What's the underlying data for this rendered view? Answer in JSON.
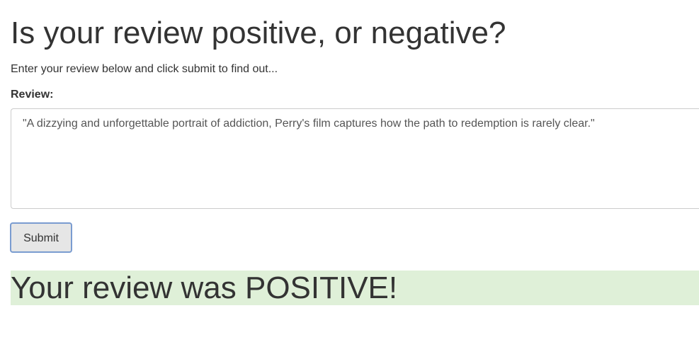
{
  "header": {
    "title": "Is your review positive, or negative?",
    "subtitle": "Enter your review below and click submit to find out..."
  },
  "form": {
    "review_label": "Review:",
    "review_value": "\"A dizzying and unforgettable portrait of addiction, Perry's film captures how the path to redemption is rarely clear.\"",
    "submit_label": "Submit"
  },
  "result": {
    "text": "Your review was POSITIVE!",
    "background_color": "#dff0d8"
  }
}
